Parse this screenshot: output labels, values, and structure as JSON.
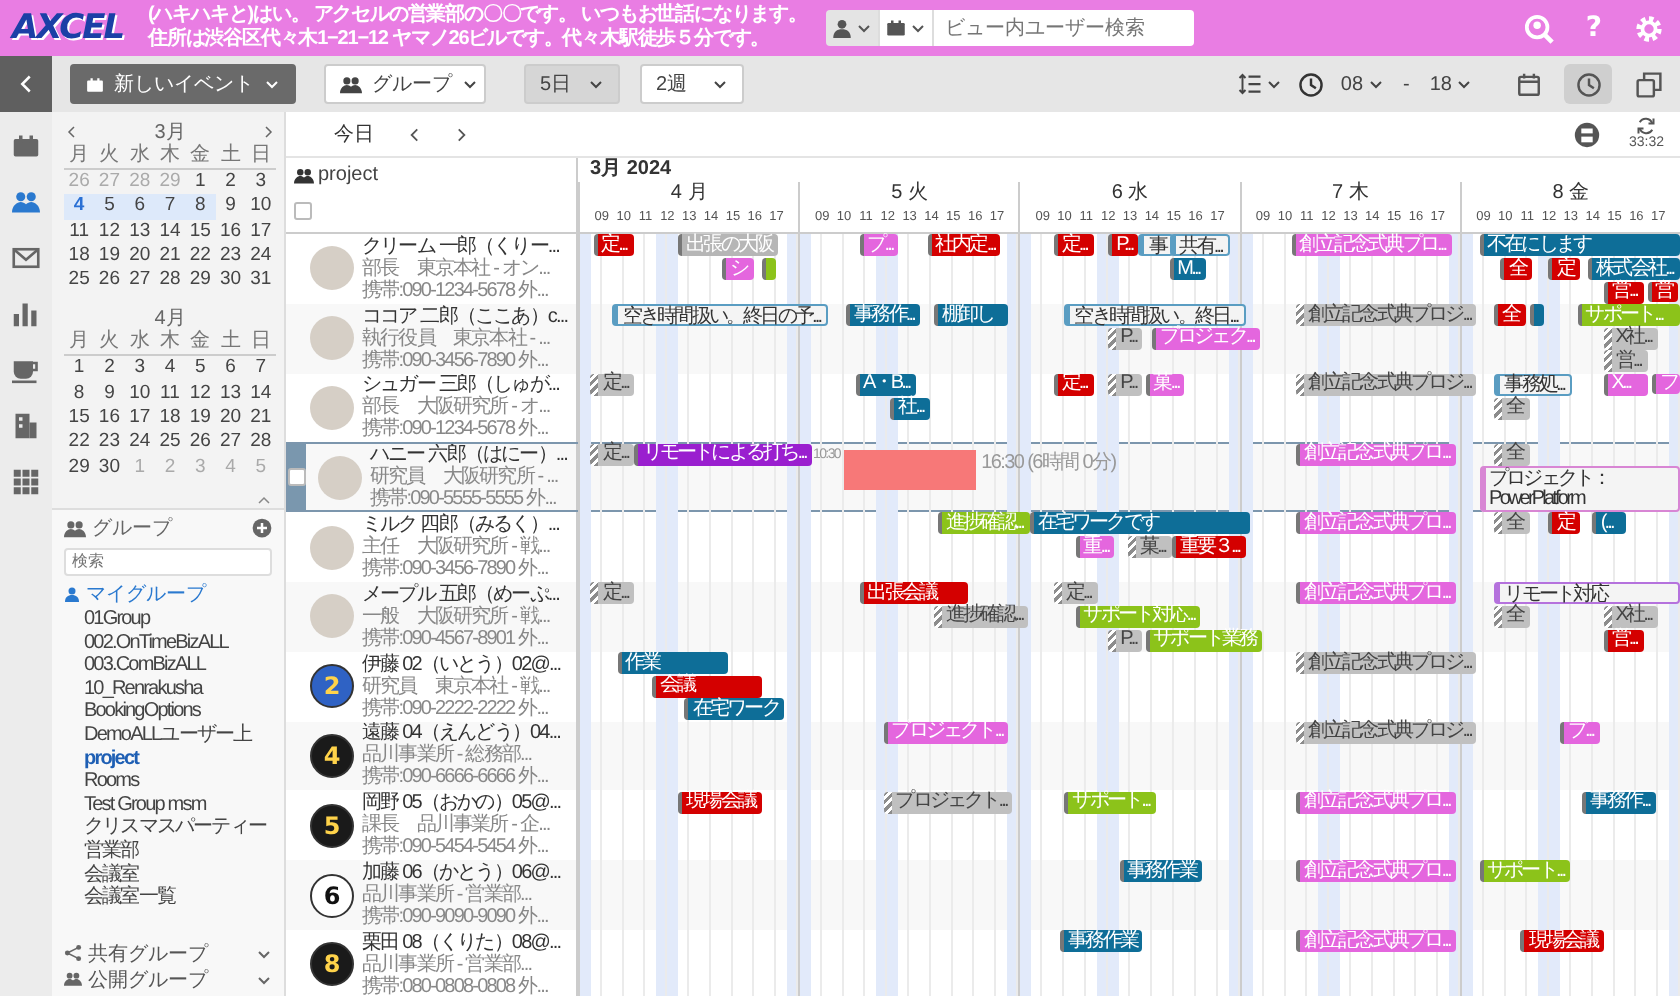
{
  "header": {
    "logo": "AXCEL",
    "message": [
      "(ハキハキと)はい。 アクセルの営業部の〇〇です。 いつもお世話になります。",
      "住所は渋谷区代々木1−21−12 ヤマノ26ビルです。代々木駅徒歩５分です。"
    ],
    "search_placeholder": "ビュー内ユーザー検索",
    "help": "?"
  },
  "toolbar": {
    "new_event": "新しいイベント",
    "group": "グループ",
    "days": "5日",
    "weeks": "2週",
    "time_from": "08",
    "time_sep": "-",
    "time_to": "18",
    "history_on": true
  },
  "nav_strip": [
    {
      "kind": "calendar",
      "selected": false
    },
    {
      "kind": "people",
      "selected": true
    },
    {
      "kind": "mail",
      "selected": false
    },
    {
      "kind": "chart",
      "selected": false
    },
    {
      "kind": "cup",
      "selected": false
    },
    {
      "kind": "building",
      "selected": false
    },
    {
      "kind": "grid",
      "selected": false
    }
  ],
  "sidebar": {
    "calendars": [
      {
        "title": "3月",
        "has_nav": true,
        "weekdays": [
          "月",
          "火",
          "水",
          "木",
          "金",
          "土",
          "日"
        ],
        "weeks": [
          [
            {
              "d": "26",
              "muted": true,
              "selected": false,
              "today": false
            },
            {
              "d": "27",
              "muted": true,
              "selected": false,
              "today": false
            },
            {
              "d": "28",
              "muted": true,
              "selected": false,
              "today": false
            },
            {
              "d": "29",
              "muted": true,
              "selected": false,
              "today": false
            },
            {
              "d": "1",
              "muted": false,
              "selected": false,
              "today": false
            },
            {
              "d": "2",
              "muted": false,
              "selected": false,
              "today": false
            },
            {
              "d": "3",
              "muted": false,
              "selected": false,
              "today": false
            }
          ],
          [
            {
              "d": "4",
              "muted": false,
              "selected": true,
              "today": true
            },
            {
              "d": "5",
              "muted": false,
              "selected": true,
              "today": false
            },
            {
              "d": "6",
              "muted": false,
              "selected": true,
              "today": false
            },
            {
              "d": "7",
              "muted": false,
              "selected": true,
              "today": false
            },
            {
              "d": "8",
              "muted": false,
              "selected": true,
              "today": false
            },
            {
              "d": "9",
              "muted": false,
              "selected": false,
              "today": false
            },
            {
              "d": "10",
              "muted": false,
              "selected": false,
              "today": false
            }
          ],
          [
            {
              "d": "11",
              "muted": false,
              "selected": false,
              "today": false
            },
            {
              "d": "12",
              "muted": false,
              "selected": false,
              "today": false
            },
            {
              "d": "13",
              "muted": false,
              "selected": false,
              "today": false
            },
            {
              "d": "14",
              "muted": false,
              "selected": false,
              "today": false
            },
            {
              "d": "15",
              "muted": false,
              "selected": false,
              "today": false
            },
            {
              "d": "16",
              "muted": false,
              "selected": false,
              "today": false
            },
            {
              "d": "17",
              "muted": false,
              "selected": false,
              "today": false
            }
          ],
          [
            {
              "d": "18",
              "muted": false,
              "selected": false,
              "today": false
            },
            {
              "d": "19",
              "muted": false,
              "selected": false,
              "today": false
            },
            {
              "d": "20",
              "muted": false,
              "selected": false,
              "today": false
            },
            {
              "d": "21",
              "muted": false,
              "selected": false,
              "today": false
            },
            {
              "d": "22",
              "muted": false,
              "selected": false,
              "today": false
            },
            {
              "d": "23",
              "muted": false,
              "selected": false,
              "today": false
            },
            {
              "d": "24",
              "muted": false,
              "selected": false,
              "today": false
            }
          ],
          [
            {
              "d": "25",
              "muted": false,
              "selected": false,
              "today": false
            },
            {
              "d": "26",
              "muted": false,
              "selected": false,
              "today": false
            },
            {
              "d": "27",
              "muted": false,
              "selected": false,
              "today": false
            },
            {
              "d": "28",
              "muted": false,
              "selected": false,
              "today": false
            },
            {
              "d": "29",
              "muted": false,
              "selected": false,
              "today": false
            },
            {
              "d": "30",
              "muted": false,
              "selected": false,
              "today": false
            },
            {
              "d": "31",
              "muted": false,
              "selected": false,
              "today": false
            }
          ]
        ]
      },
      {
        "title": "4月",
        "has_nav": false,
        "weekdays": [
          "月",
          "火",
          "水",
          "木",
          "金",
          "土",
          "日"
        ],
        "weeks": [
          [
            {
              "d": "1",
              "muted": false,
              "selected": false,
              "today": false
            },
            {
              "d": "2",
              "muted": false,
              "selected": false,
              "today": false
            },
            {
              "d": "3",
              "muted": false,
              "selected": false,
              "today": false
            },
            {
              "d": "4",
              "muted": false,
              "selected": false,
              "today": false
            },
            {
              "d": "5",
              "muted": false,
              "selected": false,
              "today": false
            },
            {
              "d": "6",
              "muted": false,
              "selected": false,
              "today": false
            },
            {
              "d": "7",
              "muted": false,
              "selected": false,
              "today": false
            }
          ],
          [
            {
              "d": "8",
              "muted": false,
              "selected": false,
              "today": false
            },
            {
              "d": "9",
              "muted": false,
              "selected": false,
              "today": false
            },
            {
              "d": "10",
              "muted": false,
              "selected": false,
              "today": false
            },
            {
              "d": "11",
              "muted": false,
              "selected": false,
              "today": false
            },
            {
              "d": "12",
              "muted": false,
              "selected": false,
              "today": false
            },
            {
              "d": "13",
              "muted": false,
              "selected": false,
              "today": false
            },
            {
              "d": "14",
              "muted": false,
              "selected": false,
              "today": false
            }
          ],
          [
            {
              "d": "15",
              "muted": false,
              "selected": false,
              "today": false
            },
            {
              "d": "16",
              "muted": false,
              "selected": false,
              "today": false
            },
            {
              "d": "17",
              "muted": false,
              "selected": false,
              "today": false
            },
            {
              "d": "18",
              "muted": false,
              "selected": false,
              "today": false
            },
            {
              "d": "19",
              "muted": false,
              "selected": false,
              "today": false
            },
            {
              "d": "20",
              "muted": false,
              "selected": false,
              "today": false
            },
            {
              "d": "21",
              "muted": false,
              "selected": false,
              "today": false
            }
          ],
          [
            {
              "d": "22",
              "muted": false,
              "selected": false,
              "today": false
            },
            {
              "d": "23",
              "muted": false,
              "selected": false,
              "today": false
            },
            {
              "d": "24",
              "muted": false,
              "selected": false,
              "today": false
            },
            {
              "d": "25",
              "muted": false,
              "selected": false,
              "today": false
            },
            {
              "d": "26",
              "muted": false,
              "selected": false,
              "today": false
            },
            {
              "d": "27",
              "muted": false,
              "selected": false,
              "today": false
            },
            {
              "d": "28",
              "muted": false,
              "selected": false,
              "today": false
            }
          ],
          [
            {
              "d": "29",
              "muted": false,
              "selected": false,
              "today": false
            },
            {
              "d": "30",
              "muted": false,
              "selected": false,
              "today": false
            },
            {
              "d": "1",
              "muted": true,
              "selected": false,
              "today": false
            },
            {
              "d": "2",
              "muted": true,
              "selected": false,
              "today": false
            },
            {
              "d": "3",
              "muted": true,
              "selected": false,
              "today": false
            },
            {
              "d": "4",
              "muted": true,
              "selected": false,
              "today": false
            },
            {
              "d": "5",
              "muted": true,
              "selected": false,
              "today": false
            }
          ]
        ]
      }
    ],
    "groups": {
      "title": "グループ",
      "search_placeholder": "検索",
      "my_group": "マイグループ",
      "items": [
        {
          "label": "01Group",
          "selected": false
        },
        {
          "label": "002.OnTimeBizALL",
          "selected": false
        },
        {
          "label": "003.ComBizALL",
          "selected": false
        },
        {
          "label": "10_Renrakusha",
          "selected": false
        },
        {
          "label": "BookingOptions",
          "selected": false
        },
        {
          "label": "DemoALLユーザー上",
          "selected": false
        },
        {
          "label": "project",
          "selected": true
        },
        {
          "label": "Rooms",
          "selected": false
        },
        {
          "label": "Test Group msm",
          "selected": false
        },
        {
          "label": "クリスマスパーティー",
          "selected": false
        },
        {
          "label": "営業部",
          "selected": false
        },
        {
          "label": "会議室",
          "selected": false
        },
        {
          "label": "会議室一覧",
          "selected": false
        }
      ],
      "shared": "共有グループ",
      "public": "公開グループ"
    }
  },
  "schedule": {
    "today": "今日",
    "refresh_time": "33:32",
    "group_name": "project",
    "select_all_checked": false,
    "month": "3月 2024",
    "days": [
      {
        "label": "4 月",
        "hours": [
          "09",
          "10",
          "11",
          "12",
          "13",
          "14",
          "15",
          "16",
          "17"
        ]
      },
      {
        "label": "5 火",
        "hours": [
          "09",
          "10",
          "11",
          "12",
          "13",
          "14",
          "15",
          "16",
          "17"
        ]
      },
      {
        "label": "6 水",
        "hours": [
          "09",
          "10",
          "11",
          "12",
          "13",
          "14",
          "15",
          "16",
          "17"
        ]
      },
      {
        "label": "7 木",
        "hours": [
          "09",
          "10",
          "11",
          "12",
          "13",
          "14",
          "15",
          "16",
          "17"
        ]
      },
      {
        "label": "8 金",
        "hours": [
          "09",
          "10",
          "11",
          "12",
          "13",
          "14",
          "15",
          "16",
          "17"
        ]
      }
    ],
    "users": [
      {
        "name": "クリーム 一郎（くりー...",
        "title": "部長　東京本社 - オン...",
        "phone": "携帯:090-1234-5678 外...",
        "avatar": {
          "kind": "photo"
        },
        "selected": false,
        "checked": false,
        "events": [
          {
            "text": "定...",
            "kind": "red"
          },
          {
            "text": "出張の大阪",
            "kind": "gray"
          },
          {
            "text": "シ",
            "kind": "pink"
          },
          {
            "kind": "green"
          },
          {
            "text": "プ...",
            "kind": "pink"
          },
          {
            "text": "社内定...",
            "kind": "red"
          },
          {
            "text": "定...",
            "kind": "red"
          },
          {
            "text": "P...",
            "kind": "red"
          },
          {
            "text": "事",
            "kind": "outline"
          },
          {
            "text": "共有...",
            "kind": "outline"
          },
          {
            "text": "M...",
            "kind": "blue"
          },
          {
            "text": "創立記念式典プロ...",
            "kind": "pink"
          },
          {
            "text": "不在にします",
            "kind": "blue"
          },
          {
            "text": "全",
            "kind": "red"
          },
          {
            "text": "定",
            "kind": "red"
          },
          {
            "text": "株式会社...",
            "kind": "blue"
          },
          {
            "text": "営...",
            "kind": "red"
          },
          {
            "text": "営",
            "kind": "red"
          }
        ]
      },
      {
        "name": "ココア 二郎（ここあ）c...",
        "title": "執行役員　東京本社 - ...",
        "phone": "携帯:090-3456-7890 外...",
        "avatar": {
          "kind": "photo"
        },
        "selected": false,
        "checked": false,
        "events": [
          {
            "text": "空き時間扱い。終日の予...",
            "kind": "outline"
          },
          {
            "text": "事務作...",
            "kind": "blue"
          },
          {
            "text": "棚卸し",
            "kind": "blue"
          },
          {
            "text": "空き時間扱い。終日...",
            "kind": "outline"
          },
          {
            "text": "P...",
            "kind": "hatched"
          },
          {
            "text": "プロジェク...",
            "kind": "pink"
          },
          {
            "text": "創立記念式典プロジ...",
            "kind": "hatched"
          },
          {
            "text": "全",
            "kind": "red"
          },
          {
            "kind": "blue"
          },
          {
            "text": "サポート...",
            "kind": "green"
          },
          {
            "text": "X社...",
            "kind": "hatched"
          },
          {
            "text": "営...",
            "kind": "hatched"
          }
        ]
      },
      {
        "name": "シュガー 三郎（しゅが...",
        "title": "部長　大阪研究所 - オ...",
        "phone": "携帯:090-1234-5678 外...",
        "avatar": {
          "kind": "photo"
        },
        "selected": false,
        "checked": false,
        "events": [
          {
            "text": "定...",
            "kind": "hatched"
          },
          {
            "text": "A・B...",
            "kind": "blue"
          },
          {
            "text": "社...",
            "kind": "blue"
          },
          {
            "text": "定...",
            "kind": "red"
          },
          {
            "text": "P...",
            "kind": "hatched"
          },
          {
            "text": "菓...",
            "kind": "pink"
          },
          {
            "text": "創立記念式典プロジ...",
            "kind": "hatched"
          },
          {
            "text": "事務処...",
            "kind": "outline"
          },
          {
            "text": "全",
            "kind": "hatched"
          },
          {
            "text": "X...",
            "kind": "pink"
          },
          {
            "text": "フ",
            "kind": "pink"
          }
        ]
      },
      {
        "name": "ハニー 六郎（はにー）...",
        "title": "研究員　大阪研究所 - ...",
        "phone": "携帯:090-5555-5555 外...",
        "avatar": {
          "kind": "photo"
        },
        "selected": true,
        "checked": false,
        "events": [
          {
            "text": "定...",
            "kind": "hatched"
          },
          {
            "text": "リモートによる打ち...",
            "kind": "purple"
          },
          {
            "text": "創立記念式典プロ...",
            "kind": "pink"
          },
          {
            "text": "全",
            "kind": "hatched"
          },
          {
            "text": "プロジェクト：PowerPlatform",
            "kind": "outline-pink"
          }
        ],
        "selection": {
          "start_label": "10:30",
          "end_label": "16:30 (6時間 0分)"
        }
      },
      {
        "name": "ミルク 四郎（みるく）...",
        "title": "主任　大阪研究所 - 戦...",
        "phone": "携帯:090-3456-7890 外...",
        "avatar": {
          "kind": "photo"
        },
        "selected": false,
        "checked": false,
        "events": [
          {
            "text": "進捗確認...",
            "kind": "green"
          },
          {
            "text": "在宅ワークです",
            "kind": "blue"
          },
          {
            "text": "重...",
            "kind": "pink"
          },
          {
            "text": "菓...",
            "kind": "hatched"
          },
          {
            "text": "重要３...",
            "kind": "red"
          },
          {
            "text": "創立記念式典プロ...",
            "kind": "pink"
          },
          {
            "text": "全",
            "kind": "hatched"
          },
          {
            "text": "定",
            "kind": "red"
          },
          {
            "text": "(...",
            "kind": "blue"
          }
        ]
      },
      {
        "name": "メープル 五郎（めーぷ...",
        "title": "一般　大阪研究所 - 戦...",
        "phone": "携帯:090-4567-8901 外...",
        "avatar": {
          "kind": "photo"
        },
        "selected": false,
        "checked": false,
        "events": [
          {
            "text": "定...",
            "kind": "hatched"
          },
          {
            "text": "出張会議",
            "kind": "red"
          },
          {
            "text": "進捗確認...",
            "kind": "hatched"
          },
          {
            "text": "定...",
            "kind": "hatched"
          },
          {
            "text": "サポート対応...",
            "kind": "green"
          },
          {
            "text": "P...",
            "kind": "hatched"
          },
          {
            "text": "サポート業務",
            "kind": "green"
          },
          {
            "text": "創立記念式典プロ...",
            "kind": "pink"
          },
          {
            "text": "リモート対応",
            "kind": "outline-purple"
          },
          {
            "text": "全",
            "kind": "hatched"
          },
          {
            "text": "X社...",
            "kind": "hatched"
          },
          {
            "text": "営...",
            "kind": "red"
          }
        ]
      },
      {
        "name": "伊藤 02（いとう）02@...",
        "title": "研究員　東京本社 - 戦...",
        "phone": "携帯:090-2222-2222 外...",
        "avatar": {
          "kind": "number",
          "text": "2",
          "color": "#2f62c4"
        },
        "selected": false,
        "checked": false,
        "events": [
          {
            "text": "作業",
            "kind": "blue"
          },
          {
            "text": "会議",
            "kind": "red"
          },
          {
            "text": "在宅ワーク",
            "kind": "blue"
          },
          {
            "text": "創立記念式典プロジ...",
            "kind": "hatched"
          }
        ]
      },
      {
        "name": "遠藤 04（えんどう）04...",
        "title": "品川事業所 - 総務部...",
        "phone": "携帯:090-6666-6666 外...",
        "avatar": {
          "kind": "number",
          "text": "4",
          "color": "#1a1a1a"
        },
        "selected": false,
        "checked": false,
        "events": [
          {
            "text": "プロジェクト...",
            "kind": "pink"
          },
          {
            "text": "創立記念式典プロジ...",
            "kind": "hatched"
          },
          {
            "text": "プ...",
            "kind": "pink"
          }
        ]
      },
      {
        "name": "岡野 05（おかの）05@...",
        "title": "課長　品川事業所 - 企...",
        "phone": "携帯:090-5454-5454 外...",
        "avatar": {
          "kind": "number",
          "text": "5",
          "color": "#1a1a1a"
        },
        "selected": false,
        "checked": false,
        "events": [
          {
            "text": "現場会議",
            "kind": "red"
          },
          {
            "text": "プロジェクト...",
            "kind": "hatched"
          },
          {
            "text": "サポート...",
            "kind": "green"
          },
          {
            "text": "創立記念式典プロ...",
            "kind": "pink"
          },
          {
            "text": "事務作...",
            "kind": "blue"
          }
        ]
      },
      {
        "name": "加藤 06（かとう）06@...",
        "title": "品川事業所 - 営業部...",
        "phone": "携帯:090-9090-9090 外...",
        "avatar": {
          "kind": "number",
          "text": "6",
          "color": "#ffffff"
        },
        "selected": false,
        "checked": false,
        "events": [
          {
            "text": "事務作業",
            "kind": "blue"
          },
          {
            "text": "創立記念式典プロ...",
            "kind": "pink"
          },
          {
            "text": "サポート...",
            "kind": "green"
          }
        ]
      },
      {
        "name": "栗田 08（くりた）08@...",
        "title": "品川事業所 - 営業部...",
        "phone": "携帯:080-0808-0808 外...",
        "avatar": {
          "kind": "number",
          "text": "8",
          "color": "#1a1a1a"
        },
        "selected": false,
        "checked": false,
        "events": [
          {
            "text": "事務作業",
            "kind": "blue"
          },
          {
            "text": "創立記念式典プロ...",
            "kind": "pink"
          },
          {
            "text": "現場会議",
            "kind": "red"
          }
        ]
      }
    ]
  }
}
